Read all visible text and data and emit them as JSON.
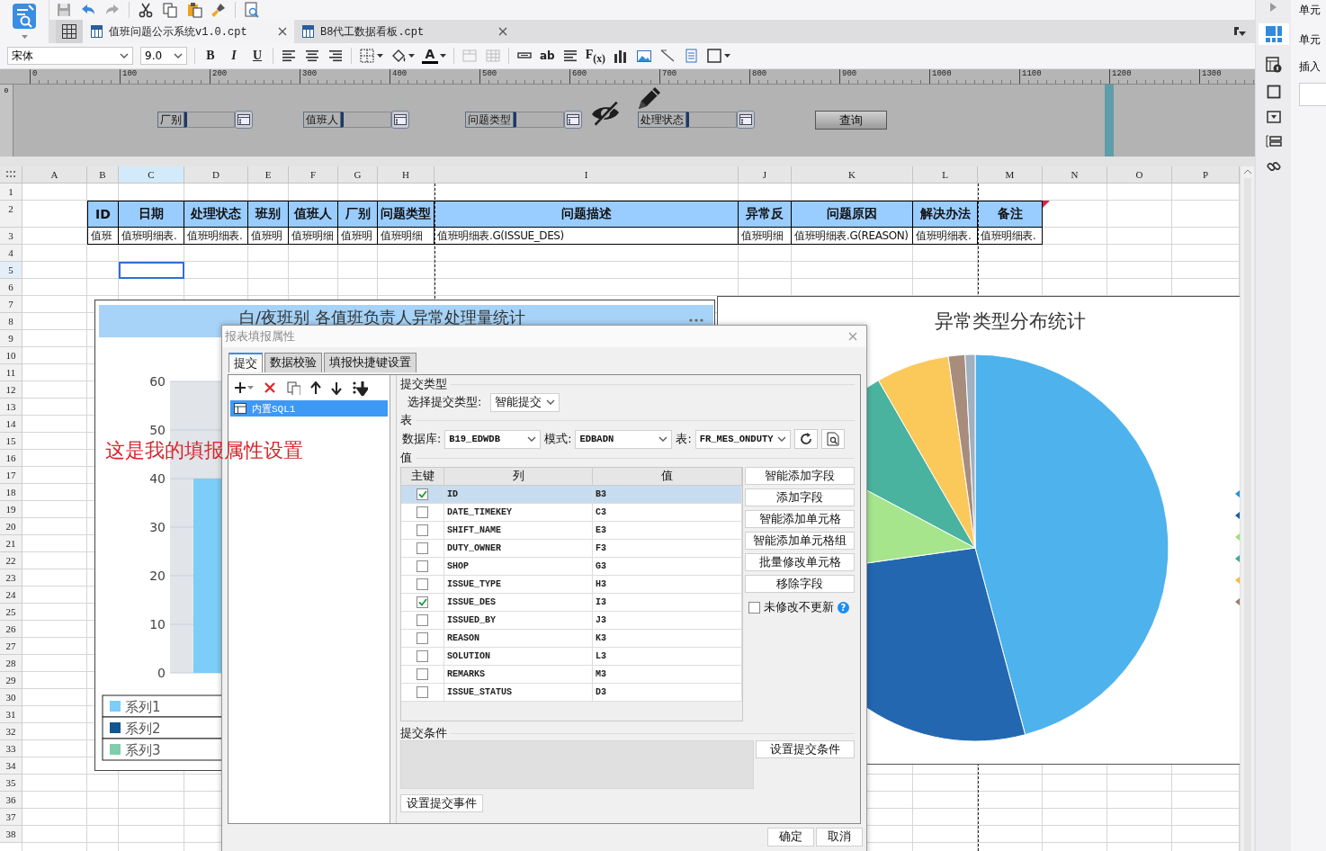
{
  "tabs": [
    {
      "label": "值班问题公示系统v1.0.cpt",
      "selected": true
    },
    {
      "label": "B8代工数据看板.cpt",
      "selected": false
    }
  ],
  "format_bar": {
    "font": "宋体",
    "size": "9.0",
    "text_buttons": [
      "B",
      "I",
      "U",
      "A",
      "ab",
      "F$_{(x)}$"
    ]
  },
  "ruler": {
    "marks": [
      "0",
      "100",
      "200",
      "300",
      "400",
      "500",
      "600",
      "700",
      "800",
      "900",
      "1000",
      "1100",
      "1200",
      "1300"
    ],
    "side_mark": "0"
  },
  "parameters": {
    "widgets": [
      {
        "label": "厂别"
      },
      {
        "label": "值班人"
      },
      {
        "label": "问题类型"
      },
      {
        "label": "处理状态"
      }
    ],
    "query_button": "查询"
  },
  "sheet": {
    "columns": [
      {
        "label": "A",
        "selected": false
      },
      {
        "label": "B",
        "selected": false
      },
      {
        "label": "C",
        "selected": true
      },
      {
        "label": "D",
        "selected": false
      },
      {
        "label": "E",
        "selected": false
      },
      {
        "label": "F",
        "selected": false
      },
      {
        "label": "G",
        "selected": false
      },
      {
        "label": "H",
        "selected": false
      },
      {
        "label": "I",
        "selected": false
      },
      {
        "label": "J",
        "selected": false
      },
      {
        "label": "K",
        "selected": false
      },
      {
        "label": "L",
        "selected": false
      },
      {
        "label": "M",
        "selected": false
      },
      {
        "label": "N",
        "selected": false
      },
      {
        "label": "O",
        "selected": false
      },
      {
        "label": "P",
        "selected": false
      }
    ],
    "rows": [
      {
        "label": "1",
        "selected": false
      },
      {
        "label": "2",
        "selected": false
      },
      {
        "label": "3",
        "selected": false
      },
      {
        "label": "4",
        "selected": false
      },
      {
        "label": "5",
        "selected": true
      },
      {
        "label": "6",
        "selected": false
      },
      {
        "label": "7",
        "selected": false
      },
      {
        "label": "8",
        "selected": false
      },
      {
        "label": "9",
        "selected": false
      },
      {
        "label": "10",
        "selected": false
      },
      {
        "label": "11",
        "selected": false
      },
      {
        "label": "12",
        "selected": false
      },
      {
        "label": "13",
        "selected": false
      },
      {
        "label": "14",
        "selected": false
      },
      {
        "label": "15",
        "selected": false
      },
      {
        "label": "16",
        "selected": false
      },
      {
        "label": "17",
        "selected": false
      },
      {
        "label": "18",
        "selected": false
      },
      {
        "label": "19",
        "selected": false
      },
      {
        "label": "20",
        "selected": false
      },
      {
        "label": "21",
        "selected": false
      },
      {
        "label": "22",
        "selected": false
      },
      {
        "label": "23",
        "selected": false
      },
      {
        "label": "24",
        "selected": false
      },
      {
        "label": "25",
        "selected": false
      },
      {
        "label": "26",
        "selected": false
      },
      {
        "label": "27",
        "selected": false
      },
      {
        "label": "28",
        "selected": false
      },
      {
        "label": "29",
        "selected": false
      },
      {
        "label": "30",
        "selected": false
      },
      {
        "label": "31",
        "selected": false
      },
      {
        "label": "32",
        "selected": false
      },
      {
        "label": "33",
        "selected": false
      },
      {
        "label": "34",
        "selected": false
      },
      {
        "label": "35",
        "selected": false
      },
      {
        "label": "36",
        "selected": false
      },
      {
        "label": "37",
        "selected": false
      },
      {
        "label": "38",
        "selected": false
      }
    ],
    "header_cells": [
      "ID",
      "日期",
      "处理状态",
      "班别",
      "值班人",
      "厂别",
      "问题类型",
      "问题描述",
      "异常反",
      "问题原因",
      "解决办法",
      "备注"
    ],
    "data_cells": [
      "值班",
      "值班明细表.",
      "值班明细表.",
      "值班明",
      "值班明细",
      "值班明",
      "值班明细",
      "值班明细表.G(ISSUE_DES)",
      "值班明细",
      "值班明细表.G(REASON)",
      "值班明细表.",
      "值班明细表."
    ]
  },
  "bar_chart": {
    "title": "白/夜班别 各值班负责人异常处理量统计",
    "annotation": "这是我的填报属性设置",
    "chart_data": {
      "type": "bar",
      "grid": true,
      "ylim": [
        0,
        60
      ],
      "yticks": [
        0,
        10,
        20,
        30,
        40,
        50,
        60
      ],
      "series": [
        {
          "name": "系列1",
          "color": "#7ccdf7",
          "values": [
            40
          ]
        },
        {
          "name": "系列2",
          "color": "#13558f",
          "values": [
            null
          ]
        },
        {
          "name": "系列3",
          "color": "#7fcdaa",
          "values": [
            null
          ]
        }
      ]
    }
  },
  "pie_chart": {
    "title": "异常类型分布统计"
  },
  "dialog": {
    "title": "报表填报属性",
    "tabs": [
      {
        "label": "提交",
        "selected": true
      },
      {
        "label": "数据校验",
        "selected": false
      },
      {
        "label": "填报快捷键设置",
        "selected": false
      }
    ],
    "submissions": [
      {
        "label": "内置SQL1",
        "selected": true
      }
    ],
    "submit_type": {
      "heading": "提交类型",
      "label": "选择提交类型:",
      "value": "智能提交"
    },
    "table_section": {
      "heading": "表",
      "database_label": "数据库:",
      "database": "B19_EDWDB",
      "schema_label": "模式:",
      "schema": "EDBADN",
      "table_label": "表:",
      "table": "FR_MES_ONDUTY"
    },
    "values_heading": "值",
    "columns": [
      "主键",
      "列",
      "值"
    ],
    "fields": [
      {
        "key": true,
        "column": "ID",
        "value": "B3",
        "selected": true
      },
      {
        "key": false,
        "column": "DATE_TIMEKEY",
        "value": "C3",
        "selected": false
      },
      {
        "key": false,
        "column": "SHIFT_NAME",
        "value": "E3",
        "selected": false
      },
      {
        "key": false,
        "column": "DUTY_OWNER",
        "value": "F3",
        "selected": false
      },
      {
        "key": false,
        "column": "SHOP",
        "value": "G3",
        "selected": false
      },
      {
        "key": false,
        "column": "ISSUE_TYPE",
        "value": "H3",
        "selected": false
      },
      {
        "key": true,
        "column": "ISSUE_DES",
        "value": "I3",
        "selected": false
      },
      {
        "key": false,
        "column": "ISSUED_BY",
        "value": "J3",
        "selected": false
      },
      {
        "key": false,
        "column": "REASON",
        "value": "K3",
        "selected": false
      },
      {
        "key": false,
        "column": "SOLUTION",
        "value": "L3",
        "selected": false
      },
      {
        "key": false,
        "column": "REMARKS",
        "value": "M3",
        "selected": false
      },
      {
        "key": false,
        "column": "ISSUE_STATUS",
        "value": "D3",
        "selected": false
      }
    ],
    "actions": [
      "智能添加字段",
      "添加字段",
      "智能添加单元格",
      "智能添加单元格组",
      "批量修改单元格",
      "移除字段"
    ],
    "unchanged_option": {
      "label": "未修改不更新",
      "checked": false,
      "help": "?"
    },
    "condition": {
      "heading": "提交条件",
      "button": "设置提交条件"
    },
    "event_button": "设置提交事件",
    "footer_buttons": [
      "确定",
      "取消"
    ]
  },
  "side_panel": {
    "labels": [
      "单元",
      "单元",
      "插入"
    ]
  }
}
